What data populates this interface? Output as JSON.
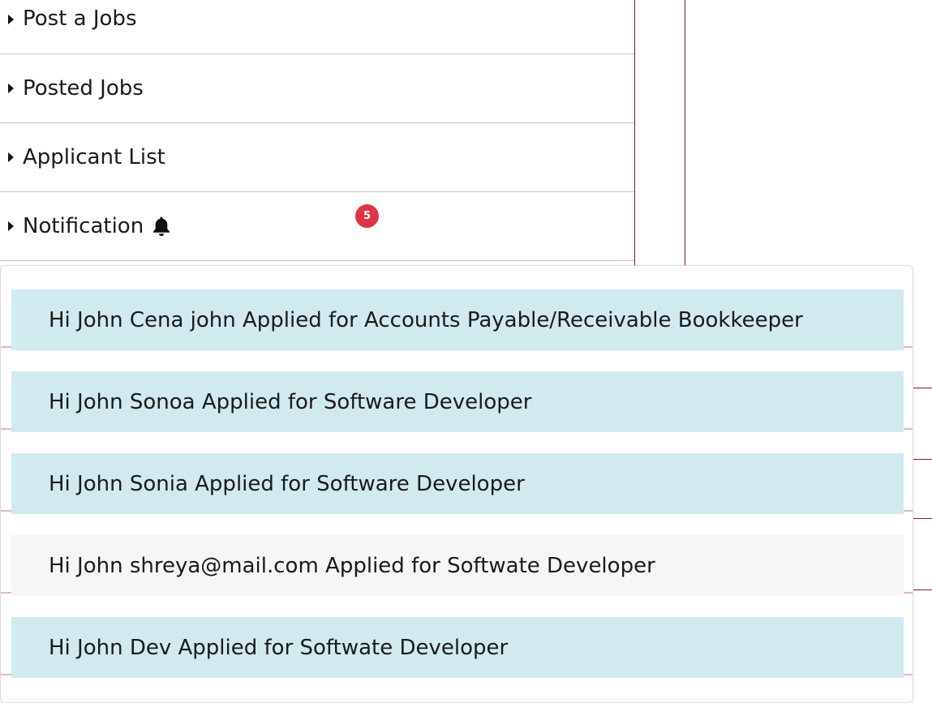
{
  "menu": {
    "items": [
      {
        "label": "Post a Jobs"
      },
      {
        "label": "Posted Jobs"
      },
      {
        "label": "Applicant List"
      },
      {
        "label": "Notification"
      }
    ],
    "notification_count": "5"
  },
  "notifications": [
    {
      "text": "Hi John Cena john Applied for Accounts Payable/Receivable Bookkeeper",
      "style": "info"
    },
    {
      "text": "Hi John Sonoa Applied for Software Developer",
      "style": "info"
    },
    {
      "text": "Hi John Sonia Applied for Software Developer",
      "style": "info"
    },
    {
      "text": "Hi John shreya@mail.com Applied for Softwate Developer",
      "style": "light"
    },
    {
      "text": "Hi John Dev Applied for Softwate Developer",
      "style": "info"
    }
  ],
  "colors": {
    "info_bg": "#d1eaf0",
    "light_bg": "#f5f6f8",
    "badge": "#dc3545",
    "divider": "#e0b8c4",
    "structure_line": "#7a1f3d"
  }
}
